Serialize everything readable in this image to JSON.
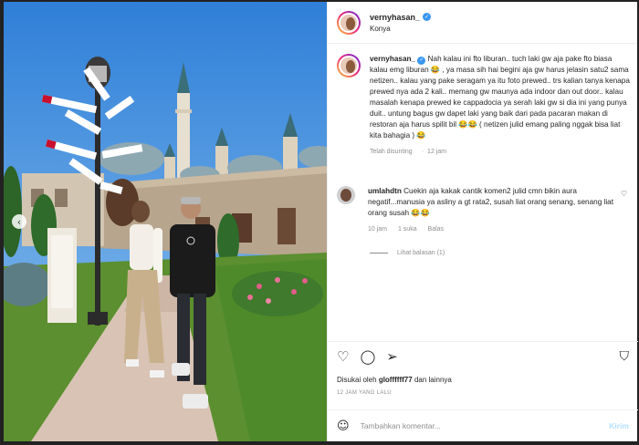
{
  "header": {
    "username": "vernyhasan_",
    "location": "Konya"
  },
  "caption": {
    "username": "vernyhasan_",
    "text": "Nah kalau ini fto liburan.. tuch laki gw aja pake fto biasa kalau emg liburan 😂 , ya masa sih hai begini aja gw harus jelasin satu2 sama netizen.. kalau yang pake seragam ya itu foto prewed.. trs kalian tanya kenapa prewed nya ada 2 kali.. memang gw maunya ada indoor dan out door.. kalau masalah kenapa prewed ke cappadocia ya serah laki gw si dia ini yang punya duit.. untung bagus gw dapet laki yang baik dari pada pacaran makan di restoran aja harus spilit bil 😂😂 ( netizen julid emang paling nggak bisa liat kita bahagia ) 😂",
    "edited": "Telah disunting",
    "time": "12 jam"
  },
  "comment": {
    "username": "umlahdtn",
    "text": "Cuekin aja kakak cantik komen2 julid cmn bikin aura negatif...manusia ya asliny a gt rata2, susah liat orang senang, senang liat orang susah 😂😂",
    "time": "10 jam",
    "likes": "1 suka",
    "reply": "Balas",
    "view_replies": "Lihat balasan (1)"
  },
  "actions": {
    "liked_by_prefix": "Disukai oleh",
    "liked_by_user": "gloffffff77",
    "liked_by_suffix": "dan lainnya",
    "timestamp": "12 JAM YANG LALU"
  },
  "add_comment": {
    "placeholder": "Tambahkan komentar...",
    "post_label": "Kirim"
  },
  "icons": {
    "like": "heart-icon",
    "comment": "comment-icon",
    "share": "share-icon",
    "save": "bookmark-icon",
    "emoji": "emoji-icon",
    "verified": "verified-badge-icon",
    "prev": "chevron-left-icon"
  },
  "colors": {
    "verified": "#3897f0",
    "post_button_disabled": "#b2dffc",
    "muted_text": "#8e8e8e"
  }
}
